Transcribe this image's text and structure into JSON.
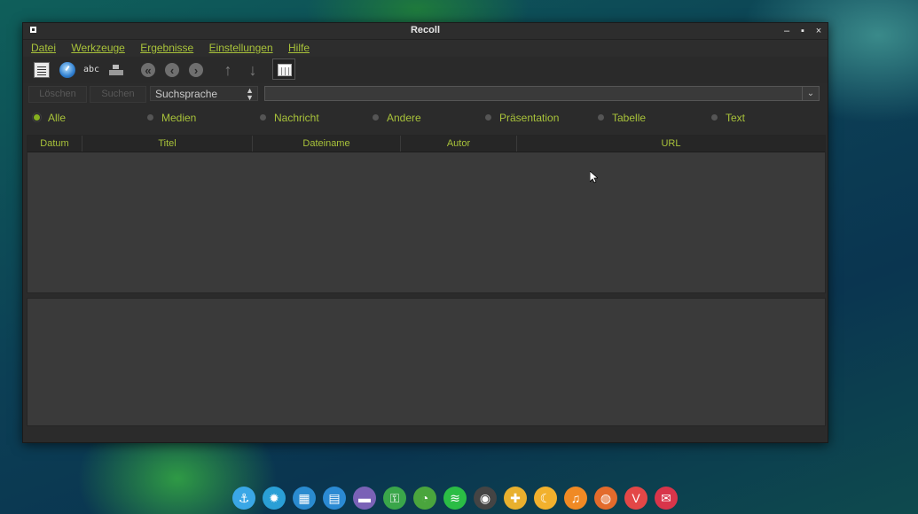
{
  "window": {
    "title": "Recoll"
  },
  "menu": [
    "Datei",
    "Werkzeuge",
    "Ergebnisse",
    "Einstellungen",
    "Hilfe"
  ],
  "toolbar": {
    "icons": [
      "query-document-icon",
      "index-clock-icon",
      "spelling-abc-icon",
      "boxes-icon",
      "first-page-icon",
      "previous-page-icon",
      "next-page-icon",
      "sort-up-icon",
      "sort-down-icon",
      "table-view-icon"
    ],
    "abc_glyph": "abc"
  },
  "search": {
    "clear_label": "Löschen",
    "search_label": "Suchen",
    "query_language": "Suchsprache",
    "query_value": ""
  },
  "filters": {
    "selected": "Alle",
    "options": [
      "Alle",
      "Medien",
      "Nachricht",
      "Andere",
      "Präsentation",
      "Tabelle",
      "Text"
    ]
  },
  "results": {
    "columns": [
      "Datum",
      "Titel",
      "Dateiname",
      "Autor",
      "URL"
    ],
    "rows": []
  },
  "dock": {
    "apps": [
      {
        "name": "anchor-icon",
        "color": "#3aa7e6",
        "glyph": "⚓"
      },
      {
        "name": "settings-icon",
        "color": "#2a9fd6",
        "glyph": "✹"
      },
      {
        "name": "monitor-icon",
        "color": "#2a8bd0",
        "glyph": "▦"
      },
      {
        "name": "document-icon",
        "color": "#2b8ad3",
        "glyph": "▤"
      },
      {
        "name": "folder-icon",
        "color": "#7a62b6",
        "glyph": "▬"
      },
      {
        "name": "key-icon",
        "color": "#3aa64a",
        "glyph": "⚿"
      },
      {
        "name": "rss-icon",
        "color": "#4aa53d",
        "glyph": "◔"
      },
      {
        "name": "spotify-icon",
        "color": "#2bbd45",
        "glyph": "≋"
      },
      {
        "name": "spy-icon",
        "color": "#444",
        "glyph": "◉"
      },
      {
        "name": "target-icon",
        "color": "#e8b02e",
        "glyph": "✚"
      },
      {
        "name": "moon-icon",
        "color": "#f2b12d",
        "glyph": "☾"
      },
      {
        "name": "headphones-icon",
        "color": "#f08a24",
        "glyph": "♫"
      },
      {
        "name": "firefox-icon",
        "color": "#e36b2c",
        "glyph": "◍"
      },
      {
        "name": "vivaldi-icon",
        "color": "#e34747",
        "glyph": "V"
      },
      {
        "name": "inbox-icon",
        "color": "#d8354a",
        "glyph": "✉"
      }
    ]
  }
}
